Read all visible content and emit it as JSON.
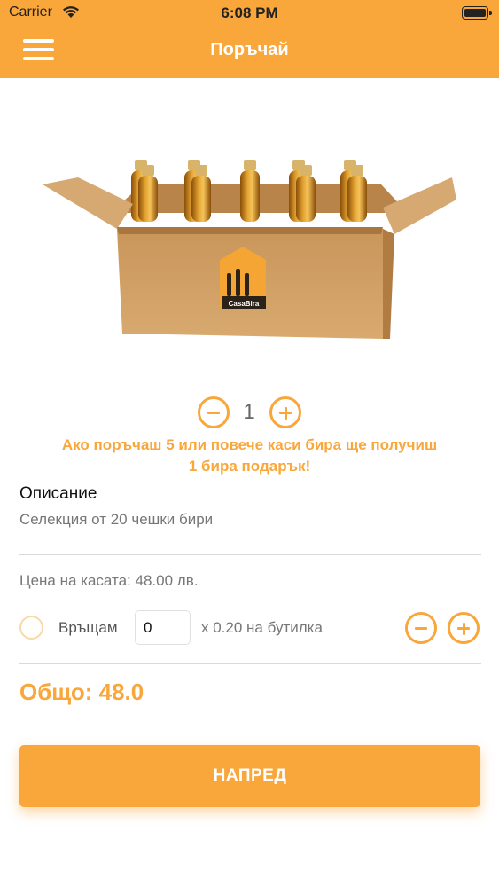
{
  "status_bar": {
    "carrier": "Carrier",
    "time": "6:08 PM"
  },
  "header": {
    "title": "Поръчай",
    "menu_icon": "hamburger-menu-icon",
    "color": "#f9a63a"
  },
  "product": {
    "image": "beer-crate-box",
    "brand_label": "CasaBira"
  },
  "quantity": {
    "value": "1",
    "decrement_icon": "minus-circle-icon",
    "increment_icon": "plus-circle-icon"
  },
  "promo": {
    "line1": "Ако поръчаш 5 или повече каси бира ще получиш",
    "line2": "1 бира подарък!"
  },
  "description": {
    "label": "Описание",
    "text": "Селекция от 20 чешки бири"
  },
  "price": {
    "text": "Цена на касата: 48.00 лв."
  },
  "return_bottles": {
    "label": "Връщам",
    "value": "0",
    "per_bottle": "x 0.20 на бутилка"
  },
  "total": {
    "text": "Общо: 48.0"
  },
  "next_button": {
    "label": "НАПРЕД"
  }
}
